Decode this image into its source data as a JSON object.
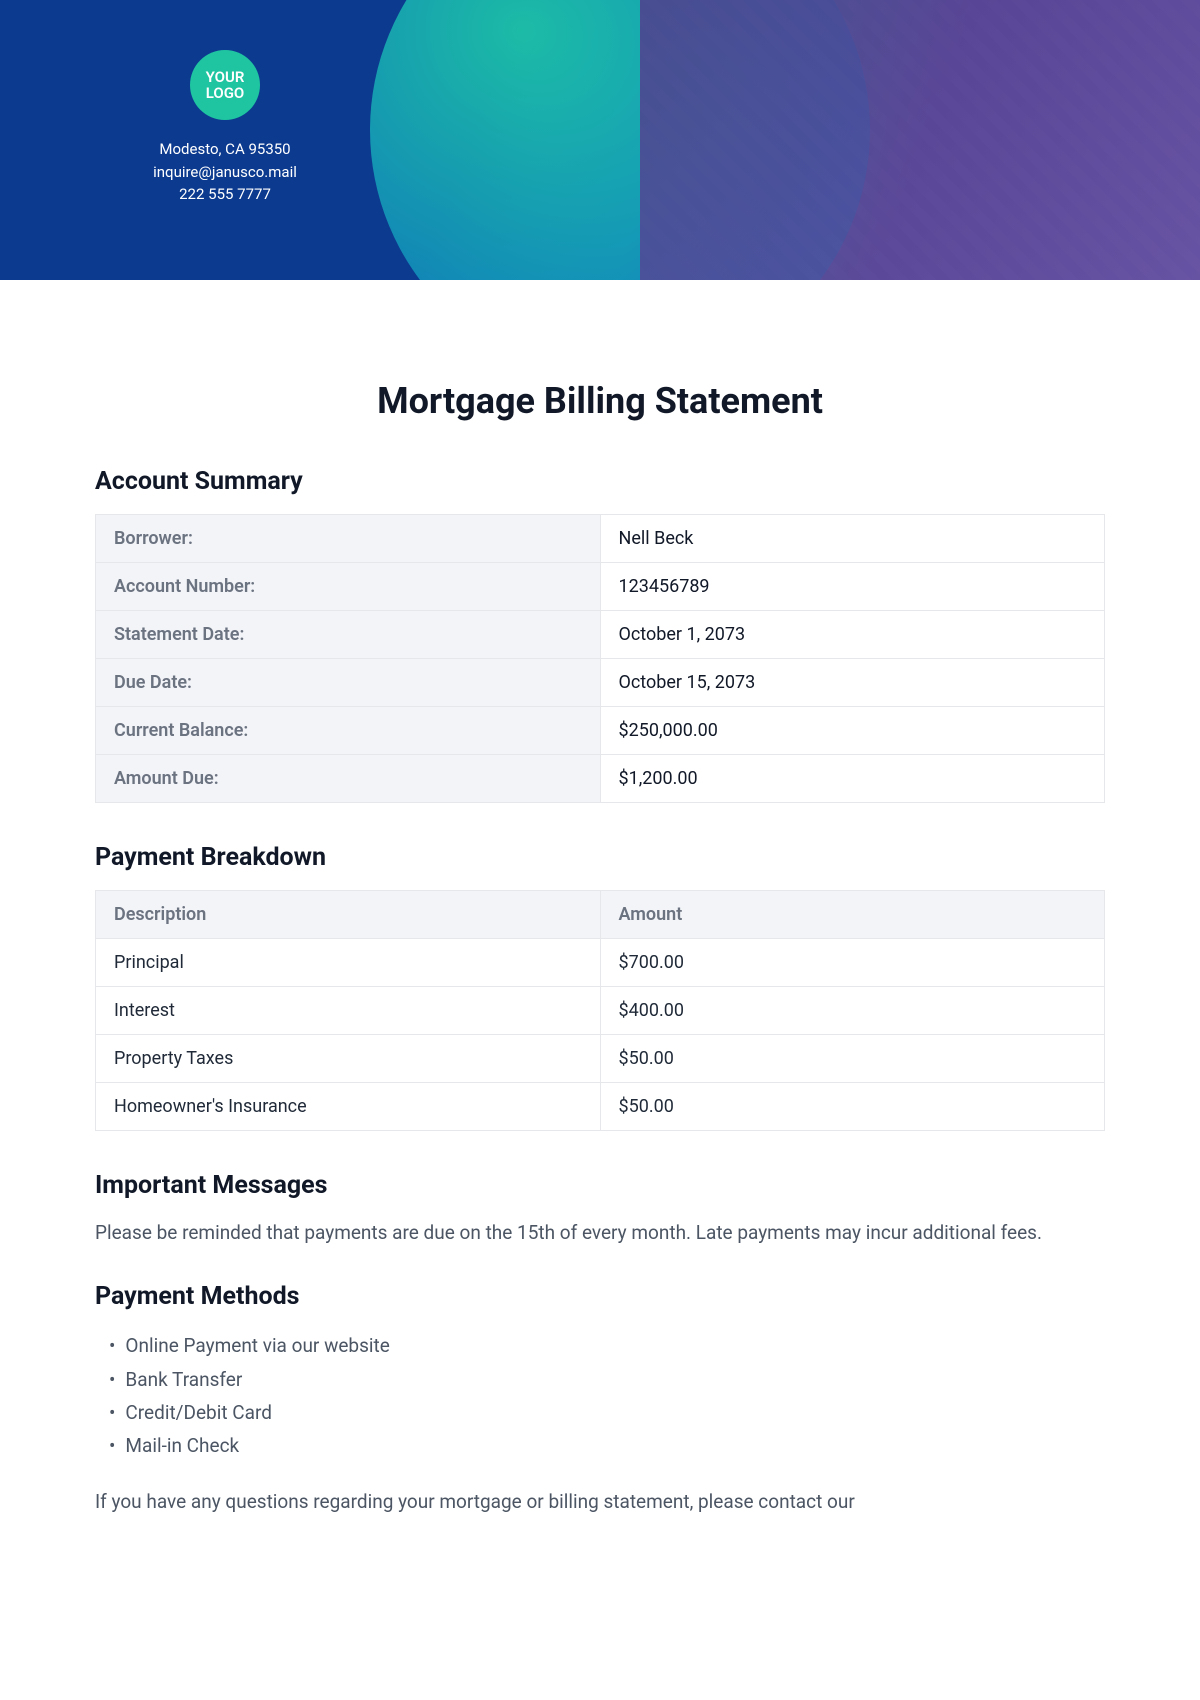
{
  "header": {
    "logo_text": "YOUR LOGO",
    "address": "Modesto, CA 95350",
    "email": "inquire@janusco.mail",
    "phone": "222 555 7777"
  },
  "title": "Mortgage Billing Statement",
  "account_summary": {
    "heading": "Account Summary",
    "rows": [
      {
        "label": "Borrower:",
        "value": "Nell Beck"
      },
      {
        "label": "Account Number:",
        "value": "123456789"
      },
      {
        "label": "Statement Date:",
        "value": "October 1, 2073"
      },
      {
        "label": "Due Date:",
        "value": "October 15, 2073"
      },
      {
        "label": "Current Balance:",
        "value": "$250,000.00"
      },
      {
        "label": "Amount Due:",
        "value": "$1,200.00"
      }
    ]
  },
  "payment_breakdown": {
    "heading": "Payment Breakdown",
    "col_description": "Description",
    "col_amount": "Amount",
    "rows": [
      {
        "description": "Principal",
        "amount": "$700.00"
      },
      {
        "description": "Interest",
        "amount": "$400.00"
      },
      {
        "description": "Property Taxes",
        "amount": "$50.00"
      },
      {
        "description": "Homeowner's Insurance",
        "amount": "$50.00"
      }
    ]
  },
  "important_messages": {
    "heading": "Important Messages",
    "text": "Please be reminded that payments are due on the 15th of every month. Late payments may incur additional fees."
  },
  "payment_methods": {
    "heading": "Payment Methods",
    "items": [
      "Online Payment via our website",
      "Bank Transfer",
      "Credit/Debit Card",
      "Mail-in Check"
    ],
    "footer_partial": "If you have any questions regarding your mortgage or billing statement, please contact our"
  }
}
